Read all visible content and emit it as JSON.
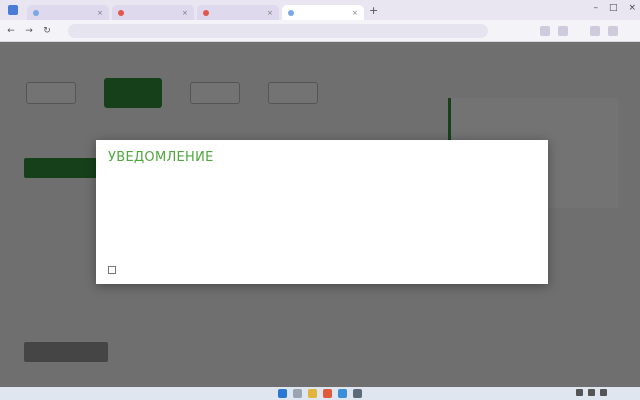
{
  "browser": {
    "tabs": [
      {
        "label": "",
        "active": false
      },
      {
        "label": "",
        "active": false
      },
      {
        "label": "",
        "active": false
      },
      {
        "label": "",
        "active": true
      }
    ],
    "address": ""
  },
  "page": {
    "site_title": "",
    "breadcrumb": "",
    "steps": [
      {
        "label": "",
        "active": false
      },
      {
        "label": "",
        "active": true
      },
      {
        "label": "",
        "active": false
      },
      {
        "label": "",
        "active": false
      }
    ],
    "green_button": "",
    "gray_button": "",
    "sidebar": {
      "title": "",
      "text": "",
      "link": ""
    }
  },
  "modal": {
    "title": "УВЕДОМЛЕНИЕ",
    "paragraphs": [
      "",
      "",
      "",
      "",
      "",
      "",
      "",
      "",
      "",
      "",
      ""
    ],
    "checkbox_label": "",
    "checkbox_checked": false
  },
  "taskbar": {
    "clock": ""
  },
  "colors": {
    "accent_green": "#2f8f3a",
    "modal_title": "#4fa63d",
    "overlay": "#000000"
  }
}
